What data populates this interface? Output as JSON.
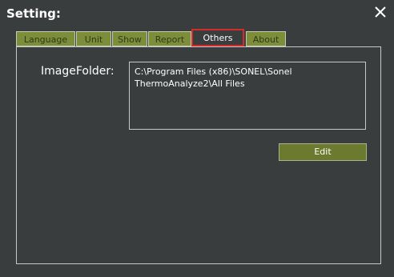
{
  "window": {
    "title": "Setting:"
  },
  "tabs": [
    {
      "label": "Language"
    },
    {
      "label": "Unit"
    },
    {
      "label": "Show"
    },
    {
      "label": "Report"
    },
    {
      "label": "Others"
    },
    {
      "label": "About"
    }
  ],
  "active_tab": "Others",
  "others": {
    "image_folder_label": "ImageFolder:",
    "image_folder_path": "C:\\Program Files (x86)\\SONEL\\Sonel ThermoAnalyze2\\All Files",
    "edit_label": "Edit"
  },
  "colors": {
    "background": "#3a3d3e",
    "tab": "#7d8d3a",
    "highlight": "#d72b2b",
    "button": "#6c7a2f"
  },
  "icons": {
    "close": "close-icon"
  }
}
